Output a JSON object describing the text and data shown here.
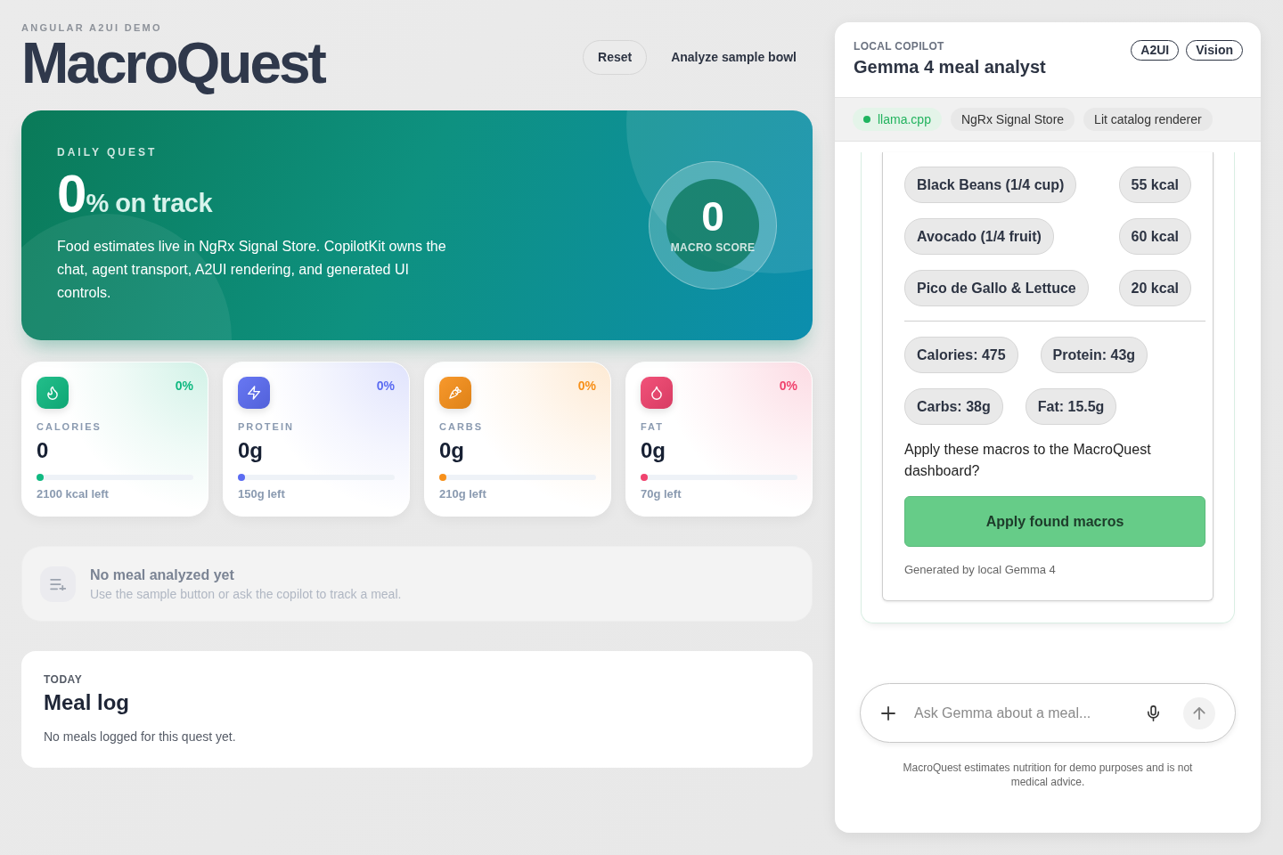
{
  "header": {
    "eyebrow": "ANGULAR A2UI DEMO",
    "title": "MacroQuest",
    "buttons": [
      {
        "label": "Reset",
        "kind": "outline"
      },
      {
        "label": "Analyze sample bowl",
        "kind": "text"
      }
    ]
  },
  "hero": {
    "eyebrow": "DAILY QUEST",
    "percent": "0",
    "percent_suffix": "% on track",
    "description": "Food estimates live in NgRx Signal Store. CopilotKit owns the chat, agent transport, A2UI rendering, and generated UI controls.",
    "score": {
      "value": "0",
      "label": "MACRO SCORE"
    }
  },
  "stats": [
    {
      "kind": "calories",
      "label": "CALORIES",
      "percent": "0%",
      "value": "0",
      "remaining": "2100 kcal left",
      "level": 0,
      "color": "#10b981"
    },
    {
      "kind": "protein",
      "label": "PROTEIN",
      "percent": "0%",
      "value": "0g",
      "remaining": "150g left",
      "level": 0,
      "color": "#5b6cf2"
    },
    {
      "kind": "carbs",
      "label": "CARBS",
      "percent": "0%",
      "value": "0g",
      "remaining": "210g left",
      "level": 0,
      "color": "#f7901a"
    },
    {
      "kind": "fat",
      "label": "FAT",
      "percent": "0%",
      "value": "0g",
      "remaining": "70g left",
      "level": 0,
      "color": "#f0436e"
    }
  ],
  "empty_state": {
    "title": "No meal analyzed yet",
    "subtitle": "Use the sample button or ask the copilot to track a meal."
  },
  "meal_log": {
    "eyebrow": "TODAY",
    "title": "Meal log",
    "empty_text": "No meals logged for this quest yet."
  },
  "copilot": {
    "eyebrow": "LOCAL COPILOT",
    "title": "Gemma 4 meal analyst",
    "badges": [
      "A2UI",
      "Vision"
    ],
    "chips": [
      {
        "label": "llama.cpp",
        "kind": "status"
      },
      {
        "label": "NgRx Signal Store",
        "kind": "plain"
      },
      {
        "label": "Lit catalog renderer",
        "kind": "plain"
      }
    ],
    "message": {
      "items": [
        {
          "name": "Black Beans (1/4 cup)",
          "calories": "55 kcal"
        },
        {
          "name": "Avocado (1/4 fruit)",
          "calories": "60 kcal"
        },
        {
          "name": "Pico de Gallo & Lettuce",
          "calories": "20 kcal"
        }
      ],
      "totals": [
        "Calories: 475",
        "Protein: 43g",
        "Carbs: 38g",
        "Fat: 15.5g"
      ],
      "question": "Apply these macros to the MacroQuest dashboard?",
      "action": "Apply found macros",
      "footer": "Generated by local Gemma 4"
    },
    "composer": {
      "placeholder": "Ask Gemma about a meal..."
    },
    "disclaimer": "MacroQuest estimates nutrition for demo purposes and is not medical advice."
  }
}
